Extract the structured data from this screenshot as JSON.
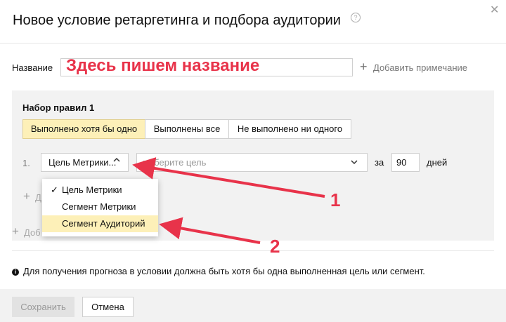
{
  "dialog": {
    "title": "Новое условие ретаргетинга и подбора аудитории",
    "help_symbol": "?",
    "close_symbol": "✕"
  },
  "name_field": {
    "label": "Название",
    "value": "",
    "overlay_text": "Здесь пишем название"
  },
  "add_note": {
    "label": "Добавить примечание"
  },
  "ruleset": {
    "title": "Набор правил 1",
    "tabs": [
      "Выполнено хотя бы одно",
      "Выполнены все",
      "Не выполнено ни одного"
    ],
    "active_tab": "Выполнено хотя бы одно",
    "rule": {
      "number": "1.",
      "type_select": "Цель Метрики...",
      "goal_placeholder": "выберите цель",
      "for_label": "за",
      "days_value": "90",
      "days_label": "дней"
    },
    "dropdown_options": [
      "Цель Метрики",
      "Сегмент Метрики",
      "Сегмент Аудиторий"
    ],
    "dropdown_checked": "Цель Метрики",
    "dropdown_highlighted": "Сегмент Аудиторий",
    "add_condition_fragment": "Д",
    "add_ruleset_fragment": "Доб"
  },
  "info": {
    "icon_symbol": "i",
    "text": "Для получения прогноза в условии должна быть хотя бы одна выполненная цель или сегмент."
  },
  "footer": {
    "save_label": "Сохранить",
    "cancel_label": "Отмена"
  },
  "annotations": [
    "1",
    "2"
  ],
  "colors": {
    "accent": "#e8334a",
    "highlight": "#fdf0b8"
  }
}
